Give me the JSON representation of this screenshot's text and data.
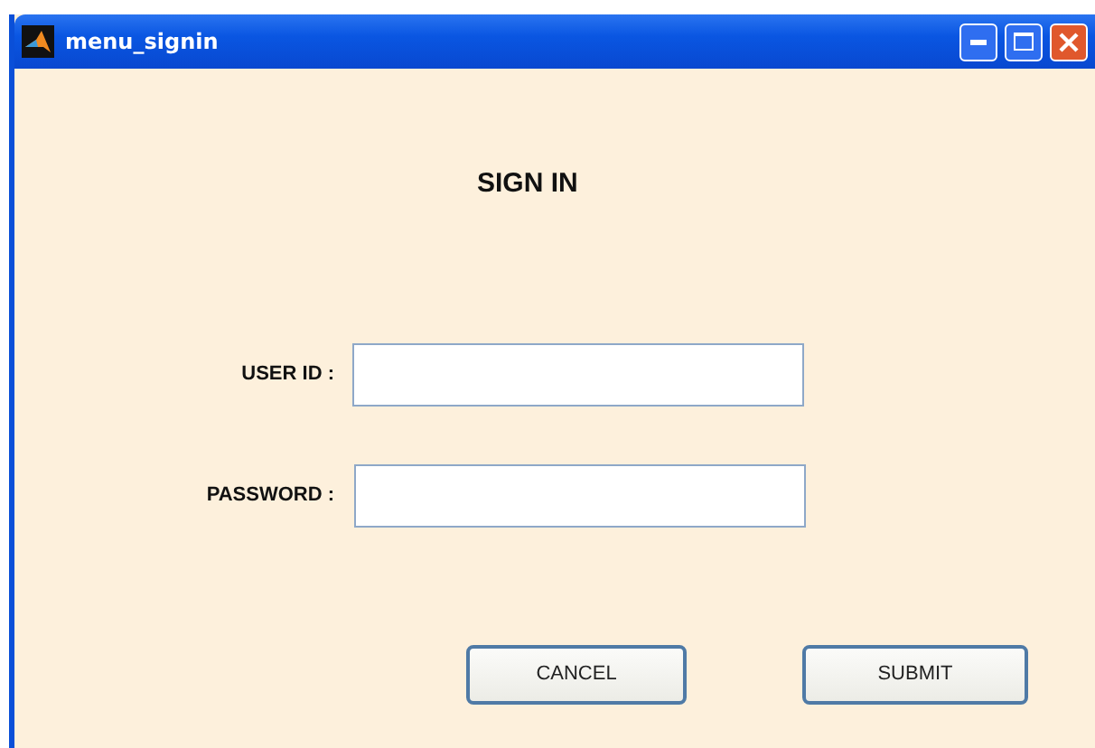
{
  "window": {
    "title": "menu_signin"
  },
  "heading": "SIGN IN",
  "fields": [
    {
      "label": "USER ID :"
    },
    {
      "label": "PASSWORD :"
    }
  ],
  "buttons": [
    "CANCEL",
    "SUBMIT"
  ]
}
